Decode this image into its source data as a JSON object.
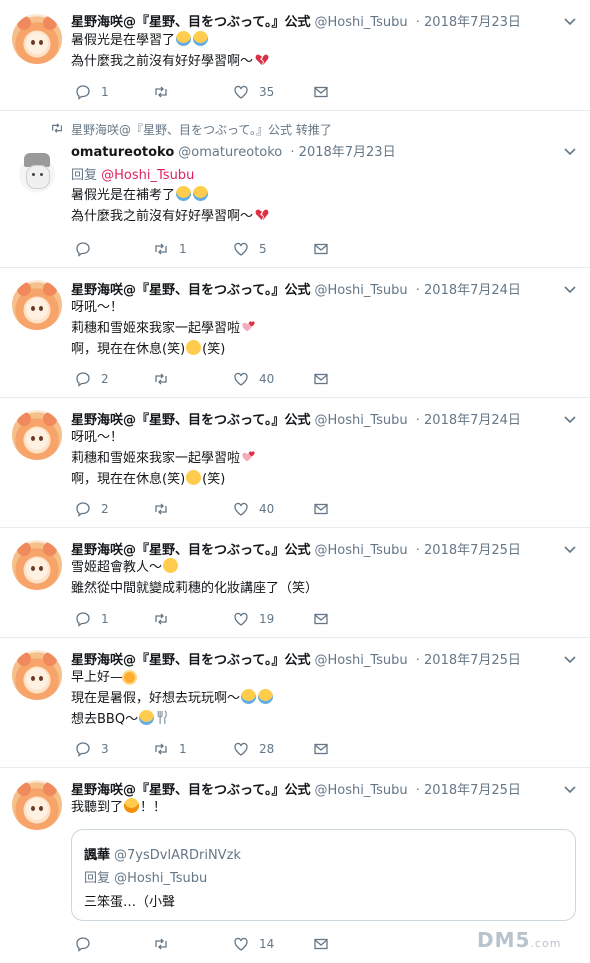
{
  "tweets": [
    {
      "name": "星野海咲@『星野、目をつぶって。』公式",
      "handle": "@Hoshi_Tsubu",
      "date": "· 2018年7月23日",
      "lines": [
        "暑假光是在學習了",
        "為什麼我之前沒有好好學習啊～"
      ],
      "reply_count": "1",
      "retweet_count": "",
      "like_count": "35"
    },
    {
      "retweeted_by": "星野海咲@『星野、目をつぶって。』公式 转推了",
      "name": "omatureotoko",
      "handle": "@omatureotoko",
      "date": "· 2018年7月23日",
      "reply_prefix": "回复",
      "reply_target": "@Hoshi_Tsubu",
      "lines": [
        "暑假光是在補考了",
        "為什麼我之前沒有好好學習啊～"
      ],
      "reply_count": "",
      "retweet_count": "1",
      "like_count": "5"
    },
    {
      "name": "星野海咲@『星野、目をつぶって。』公式",
      "handle": "@Hoshi_Tsubu",
      "date": "· 2018年7月24日",
      "lines": [
        "呀吼～！",
        "莉穗和雪姬來我家一起學習啦",
        "啊，現在在休息(笑)",
        "(笑)"
      ],
      "reply_count": "2",
      "retweet_count": "",
      "like_count": "40"
    },
    {
      "name": "星野海咲@『星野、目をつぶって。』公式",
      "handle": "@Hoshi_Tsubu",
      "date": "· 2018年7月24日",
      "lines": [
        "呀吼～！",
        "莉穗和雪姬來我家一起學習啦",
        "啊，現在在休息(笑)",
        "(笑)"
      ],
      "reply_count": "2",
      "retweet_count": "",
      "like_count": "40"
    },
    {
      "name": "星野海咲@『星野、目をつぶって。』公式",
      "handle": "@Hoshi_Tsubu",
      "date": "· 2018年7月25日",
      "lines": [
        "雪姬超會教人～",
        "雖然從中間就變成莉穗的化妝講座了（笑）"
      ],
      "reply_count": "1",
      "retweet_count": "",
      "like_count": "19"
    },
    {
      "name": "星野海咲@『星野、目をつぶって。』公式",
      "handle": "@Hoshi_Tsubu",
      "date": "· 2018年7月25日",
      "lines": [
        "早上好—",
        "現在是暑假，好想去玩玩啊～",
        "想去BBQ～"
      ],
      "reply_count": "3",
      "retweet_count": "1",
      "like_count": "28"
    },
    {
      "name": "星野海咲@『星野、目をつぶって。』公式",
      "handle": "@Hoshi_Tsubu",
      "date": "· 2018年7月25日",
      "lines": [
        "我聽到了",
        "！！"
      ],
      "reply_count": "",
      "retweet_count": "",
      "like_count": "14",
      "quote": {
        "name": "諷華",
        "handle": "@7ysDvlARDriNVzk",
        "reply": "回复 @Hoshi_Tsubu",
        "text": "三笨蛋…（小聲"
      }
    }
  ],
  "icons": {
    "reply": "reply-icon",
    "retweet": "retweet-icon",
    "like": "heart-icon",
    "message": "envelope-icon",
    "more": "chevron-down-icon"
  },
  "colors": {
    "accent": "#e0245e",
    "muted": "#657786",
    "border": "#e6ecf0"
  },
  "watermark": {
    "main": "DM5",
    "suffix": ".com"
  }
}
